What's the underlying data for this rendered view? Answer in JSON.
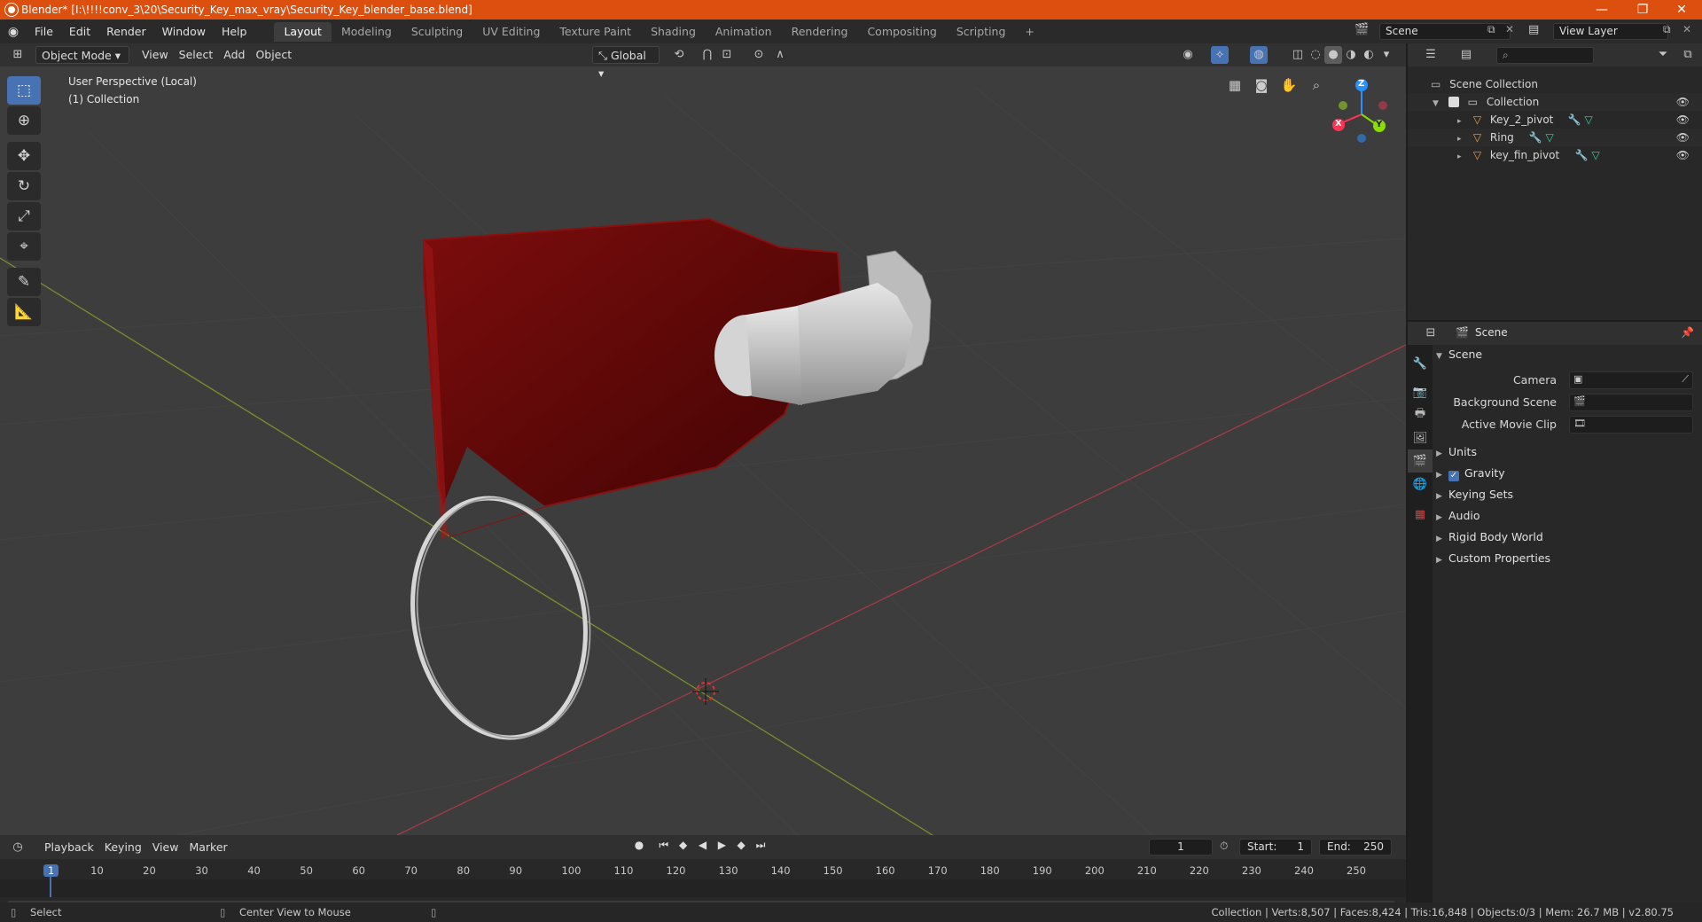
{
  "window": {
    "title": "Blender* [I:\\!!!!conv_3\\20\\Security_Key_max_vray\\Security_Key_blender_base.blend]",
    "minimize": "—",
    "restore": "❐",
    "close": "✕"
  },
  "menu": [
    "File",
    "Edit",
    "Render",
    "Window",
    "Help"
  ],
  "workspaces": [
    "Layout",
    "Modeling",
    "Sculpting",
    "UV Editing",
    "Texture Paint",
    "Shading",
    "Animation",
    "Rendering",
    "Compositing",
    "Scripting"
  ],
  "workspace_add": "+",
  "scene_field": "Scene",
  "view_layer_field": "View Layer",
  "viewport": {
    "mode": "Object Mode",
    "menus": [
      "View",
      "Select",
      "Add",
      "Object"
    ],
    "transform_orientation": "Global",
    "perspective_label": "User Perspective (Local)",
    "collection_label": "(1) Collection",
    "axes": {
      "x": "X",
      "y": "Y",
      "z": "Z"
    }
  },
  "outliner": {
    "root": "Scene Collection",
    "collection": "Collection",
    "objects": [
      "Key_2_pivot",
      "Ring",
      "key_fin_pivot"
    ]
  },
  "properties": {
    "context": "Scene",
    "panel": "Scene",
    "fields": [
      {
        "label": "Camera",
        "value": ""
      },
      {
        "label": "Background Scene",
        "value": ""
      },
      {
        "label": "Active Movie Clip",
        "value": ""
      }
    ],
    "subpanels": [
      "Units",
      "Gravity",
      "Keying Sets",
      "Audio",
      "Rigid Body World",
      "Custom Properties"
    ],
    "gravity_enabled": true
  },
  "timeline": {
    "menus": [
      "Playback",
      "Keying",
      "View",
      "Marker"
    ],
    "current_frame": "1",
    "start_label": "Start:",
    "start": "1",
    "end_label": "End:",
    "end": "250",
    "ruler": [
      "1",
      "10",
      "20",
      "30",
      "40",
      "50",
      "60",
      "70",
      "80",
      "90",
      "100",
      "110",
      "120",
      "130",
      "140",
      "150",
      "160",
      "170",
      "180",
      "190",
      "200",
      "210",
      "220",
      "230",
      "240",
      "250"
    ]
  },
  "status": {
    "left_action": "Select",
    "middle_action": "Center View to Mouse",
    "stats": "Collection | Verts:8,507 | Faces:8,424 | Tris:16,848 | Objects:0/3 | Mem: 26.7 MB | v2.80.75"
  },
  "colors": {
    "title_bar": "#dc4f0f",
    "accent": "#4772b3",
    "key_red": "#6b0a0a",
    "axis_x": "#ff3352",
    "axis_y": "#8bdc00",
    "axis_z": "#2890ff"
  }
}
